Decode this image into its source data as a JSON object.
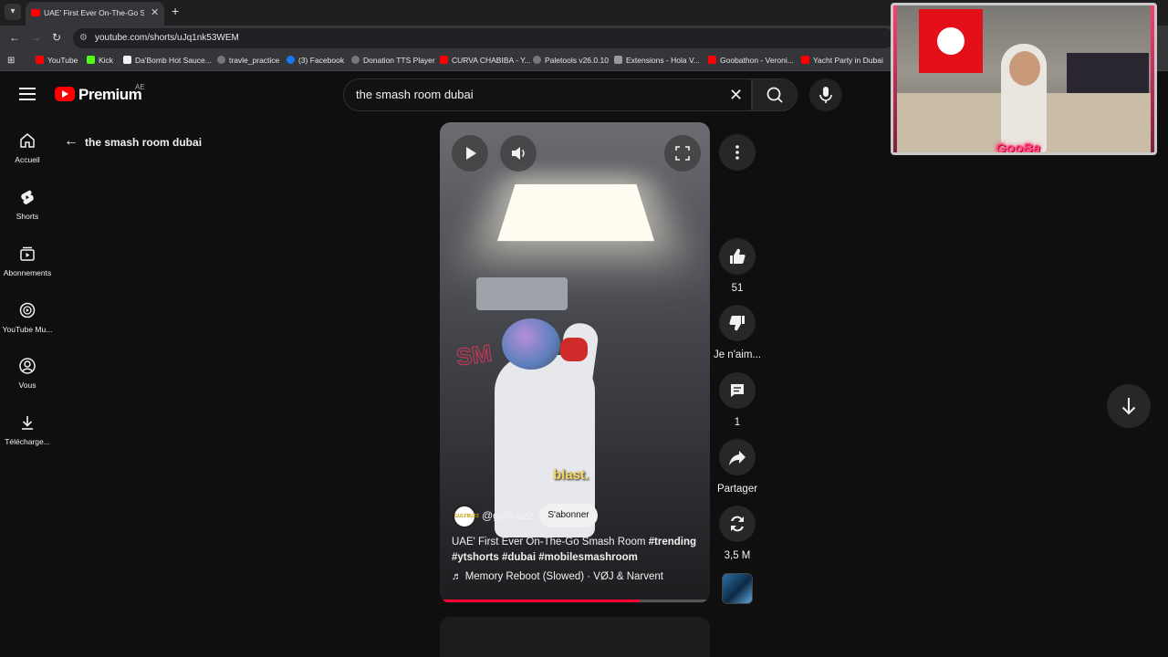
{
  "browser": {
    "tab_title": "UAE' First Ever On-The-Go Smash Room",
    "url": "youtube.com/shorts/uJq1nk53WEM",
    "bookmarks": [
      {
        "label": "YouTube",
        "color": "#ff0000"
      },
      {
        "label": "Kick",
        "color": "#53fc18"
      },
      {
        "label": "Da'Bomb Hot Sauce...",
        "color": "#f1f1f1"
      },
      {
        "label": "travle_practice",
        "color": "#aaaaaa"
      },
      {
        "label": "(3) Facebook",
        "color": "#1877f2"
      },
      {
        "label": "Donation TTS Player",
        "color": "#aaaaaa"
      },
      {
        "label": "CURVA CHABIBA - Y...",
        "color": "#ff0000"
      },
      {
        "label": "Paletools v26.0.10",
        "color": "#aaaaaa"
      },
      {
        "label": "Extensions - Hola V...",
        "color": "#aaaaaa"
      },
      {
        "label": "Goobathon - Veroni...",
        "color": "#ff0000"
      },
      {
        "label": "Yacht Party in Dubai",
        "color": "#ff0000"
      }
    ]
  },
  "header": {
    "logo_text": "Premium",
    "region": "AE",
    "search_value": "the smash room dubai"
  },
  "sidebar": {
    "items": [
      {
        "label": "Accueil",
        "icon": "home-icon"
      },
      {
        "label": "Shorts",
        "icon": "shorts-icon"
      },
      {
        "label": "Abonnements",
        "icon": "subscriptions-icon"
      },
      {
        "label": "YouTube Mu...",
        "icon": "youtube-music-icon"
      },
      {
        "label": "Vous",
        "icon": "you-icon"
      },
      {
        "label": "Télécharge...",
        "icon": "download-icon"
      }
    ]
  },
  "breadcrumb": {
    "label": "the smash room dubai"
  },
  "video": {
    "caption_word": "blast.",
    "neon_sign": "SM",
    "channel_avatar_text": "GULFBUZZ",
    "channel": "@gulfbuzz",
    "subscribe_label": "S'abonner",
    "title_plain": "UAE' First Ever On-The-Go Smash Room ",
    "title_tags_1": "#trending",
    "title_tags_2": "#ytshorts #dubai #mobilesmashroom",
    "music": "Memory Reboot (Slowed) · VØJ & Narvent",
    "progress": 0.74
  },
  "actions": {
    "likes": "51",
    "dislike_label": "Je n'aim...",
    "comments": "1",
    "share_label": "Partager",
    "remix_count": "3,5 M"
  },
  "webcam": {
    "tag": "GooBa"
  },
  "colors": {
    "accent": "#ff0000",
    "progress": "#ff0033",
    "background": "#0f0f0f"
  }
}
